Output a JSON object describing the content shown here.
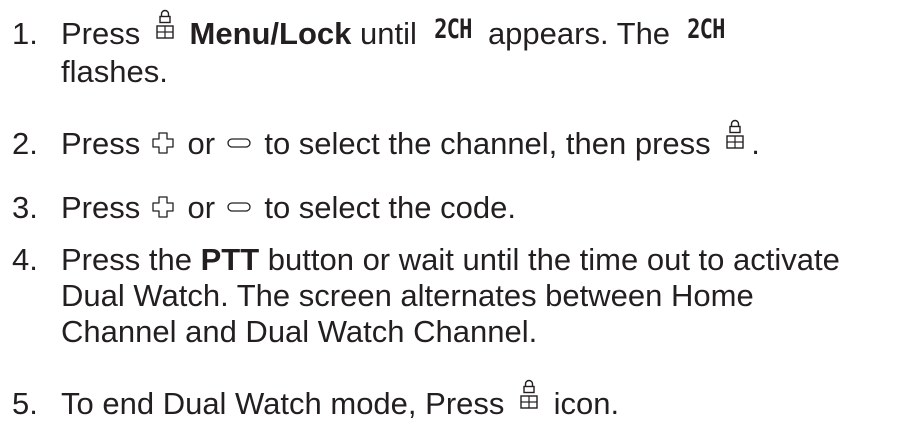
{
  "steps": [
    {
      "num": "1.",
      "press": "Press",
      "menu_lock": "Menu/Lock",
      "until": "until",
      "lcd_code": "2CH",
      "appears": "appears. The",
      "lcd_code_2": "2CH",
      "flashes": "flashes."
    },
    {
      "num": "2.",
      "press": "Press",
      "or": "or",
      "rest": "to select the channel, then press",
      "period": "."
    },
    {
      "num": "3.",
      "press": "Press",
      "or": "or",
      "rest": "to select the code."
    },
    {
      "num": "4.",
      "before": "Press the",
      "ptt": "PTT",
      "line1_rest": "button or wait until the time out to activate",
      "line2": "Dual Watch. The screen alternates between Home",
      "line3": "Channel and Dual Watch Channel."
    },
    {
      "num": "5.",
      "text": "To end Dual Watch mode, Press",
      "icon_word": "icon."
    }
  ],
  "icons": {
    "menu_lock": "menu-lock-icon",
    "up": "up-arrow-key-icon",
    "down": "down-arrow-key-icon"
  }
}
